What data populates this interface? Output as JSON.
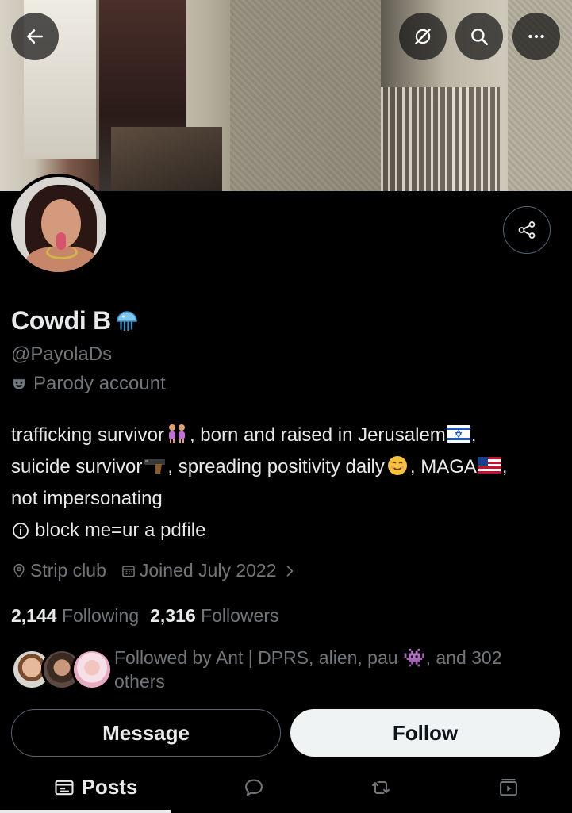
{
  "profile": {
    "name": "Cowdi B",
    "name_emoji": "jellyfish-emoji",
    "handle": "@PayolaDs",
    "parody_label": "Parody account"
  },
  "bio": {
    "line1a": "trafficking survivor",
    "line1b": ", born and raised in Jerusalem",
    "line1c": ",",
    "line2a": "suicide survivor",
    "line2b": ", spreading positivity daily",
    "line2c": ", MAGA",
    "line2d": ",",
    "line3": "not impersonating",
    "line4": "block me=ur a pdfile"
  },
  "meta": {
    "location": "Strip club",
    "joined": "Joined July 2022"
  },
  "stats": {
    "following_count": "2,144",
    "following_label": "Following",
    "followers_count": "2,316",
    "followers_label": "Followers"
  },
  "followed_by": {
    "text": "Followed by Ant | DPRS, alien, pau 👾, and 302 others"
  },
  "buttons": {
    "message": "Message",
    "follow": "Follow"
  },
  "tabs": {
    "posts": "Posts"
  },
  "icons": {
    "back": "arrow-left-icon",
    "no_grok": "slash-circle-icon",
    "search": "search-icon",
    "more": "more-icon",
    "share": "share-icon"
  },
  "colors": {
    "background": "#000000",
    "text_primary": "#e7e9ea",
    "text_secondary": "#71767b",
    "border": "#536471",
    "follow_bg": "#eff3f4"
  }
}
